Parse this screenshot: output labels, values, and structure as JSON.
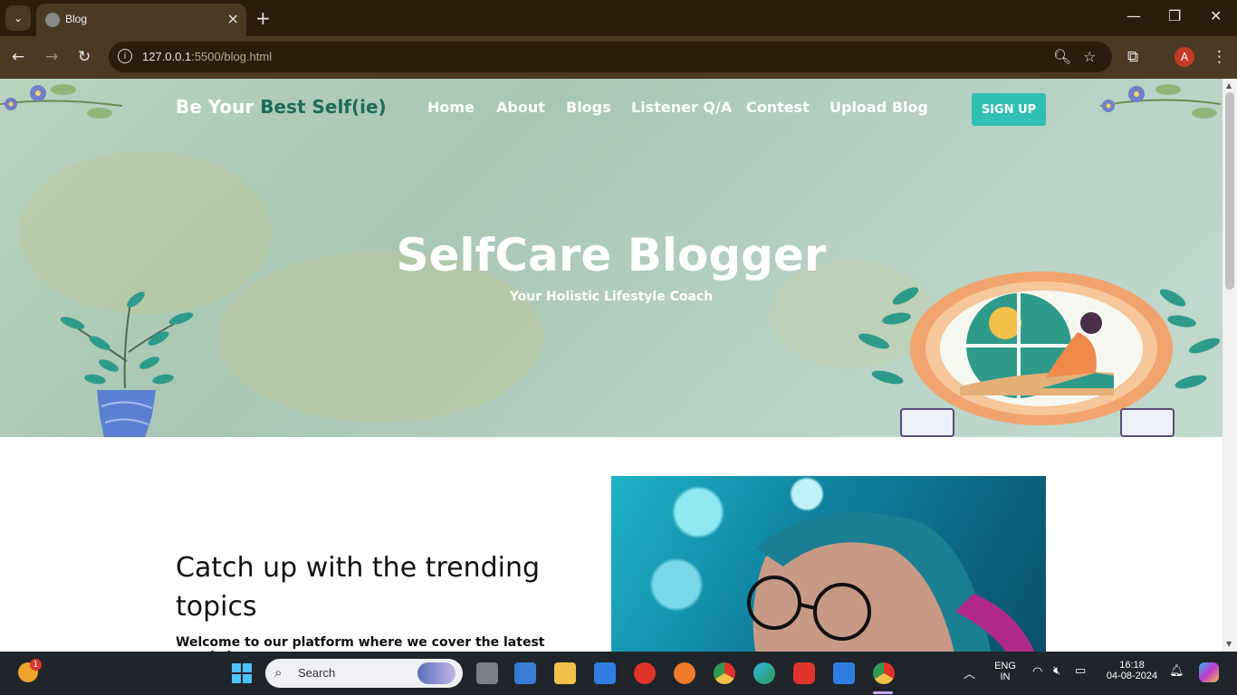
{
  "browser": {
    "tab_title": "Blog",
    "url_host": "127.0.0.1",
    "url_rest": ":5500/blog.html"
  },
  "site": {
    "logo_prefix": "Be Your ",
    "logo_accent": "Best Self(ie)",
    "nav": [
      "Home",
      "About",
      "Blogs",
      "Listener Q/A",
      "Contest",
      "Upload Blog"
    ],
    "signup_label": "SIGN UP",
    "hero_title": "SelfCare Blogger",
    "hero_subtitle": "Your Holistic Lifestyle Coach",
    "section_title": "Catch up with the trending topics",
    "section_text": "Welcome to our platform where we cover the latest trends in"
  },
  "taskbar": {
    "search_placeholder": "Search",
    "lang_top": "ENG",
    "lang_bottom": "IN",
    "time": "16:18",
    "date": "04-08-2024",
    "notif_badge": "1"
  },
  "colors": {
    "accent": "#1d6b5a",
    "signup": "#2fbfb3"
  }
}
